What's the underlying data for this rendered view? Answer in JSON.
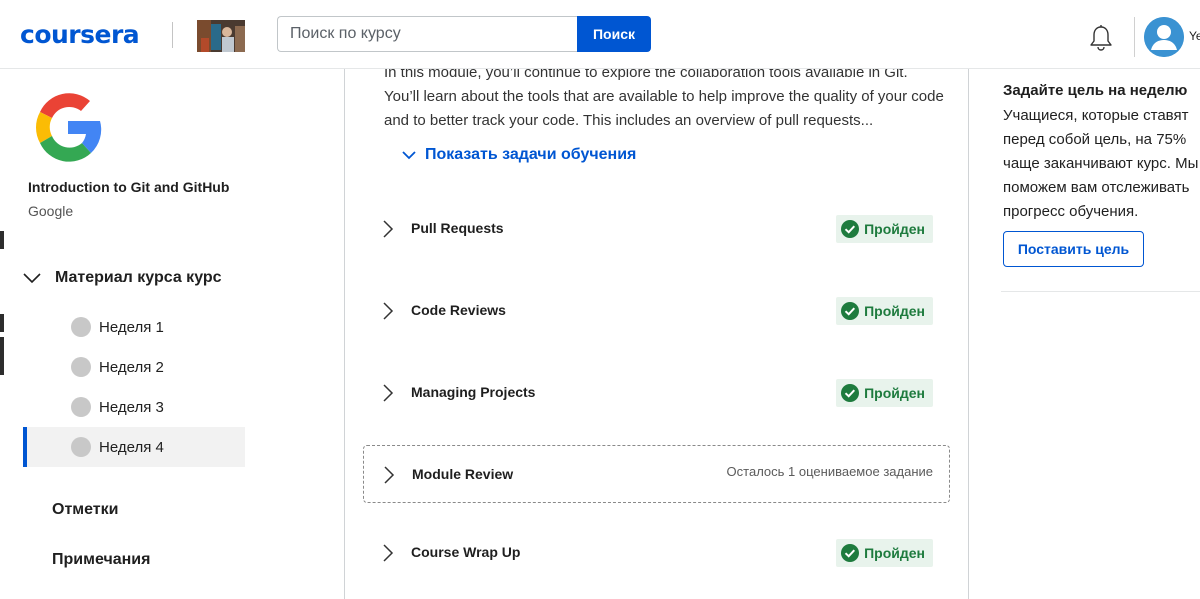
{
  "header": {
    "logo_text": "coursera",
    "search_placeholder": "Поиск по курсу",
    "search_button": "Поиск",
    "user_name": "Ye",
    "brand_color": "#0056d2"
  },
  "sidebar": {
    "course_title": "Introduction to Git and GitHub",
    "course_partner": "Google",
    "material_label": "Материал курса курс",
    "weeks": [
      {
        "label": "Неделя 1",
        "active": false
      },
      {
        "label": "Неделя 2",
        "active": false
      },
      {
        "label": "Неделя 3",
        "active": false
      },
      {
        "label": "Неделя 4",
        "active": true
      }
    ],
    "grades_label": "Отметки",
    "notes_label": "Примечания"
  },
  "main": {
    "description": "In this module, you’ll continue to explore the collaboration tools available in Git. You’ll learn about the tools that are available to help improve the quality of your code and to better track your code. This includes an overview of pull requests...",
    "show_tasks_label": "Показать задачи обучения",
    "lessons": [
      {
        "title": "Pull Requests",
        "status": "Пройден"
      },
      {
        "title": "Code Reviews",
        "status": "Пройден"
      },
      {
        "title": "Managing Projects",
        "status": "Пройден"
      },
      {
        "title": "Module Review",
        "remaining": "Осталось 1 оцениваемое задание"
      },
      {
        "title": "Course Wrap Up",
        "status": "Пройден"
      }
    ],
    "completed_color": "#1e7b3e"
  },
  "goal": {
    "title": "Задайте цель на неделю",
    "text": "Учащиеся, которые ставят перед собой цель, на 75% чаще заканчивают курс. Мы поможем вам отслеживать прогресс обучения.",
    "button": "Поставить цель"
  }
}
